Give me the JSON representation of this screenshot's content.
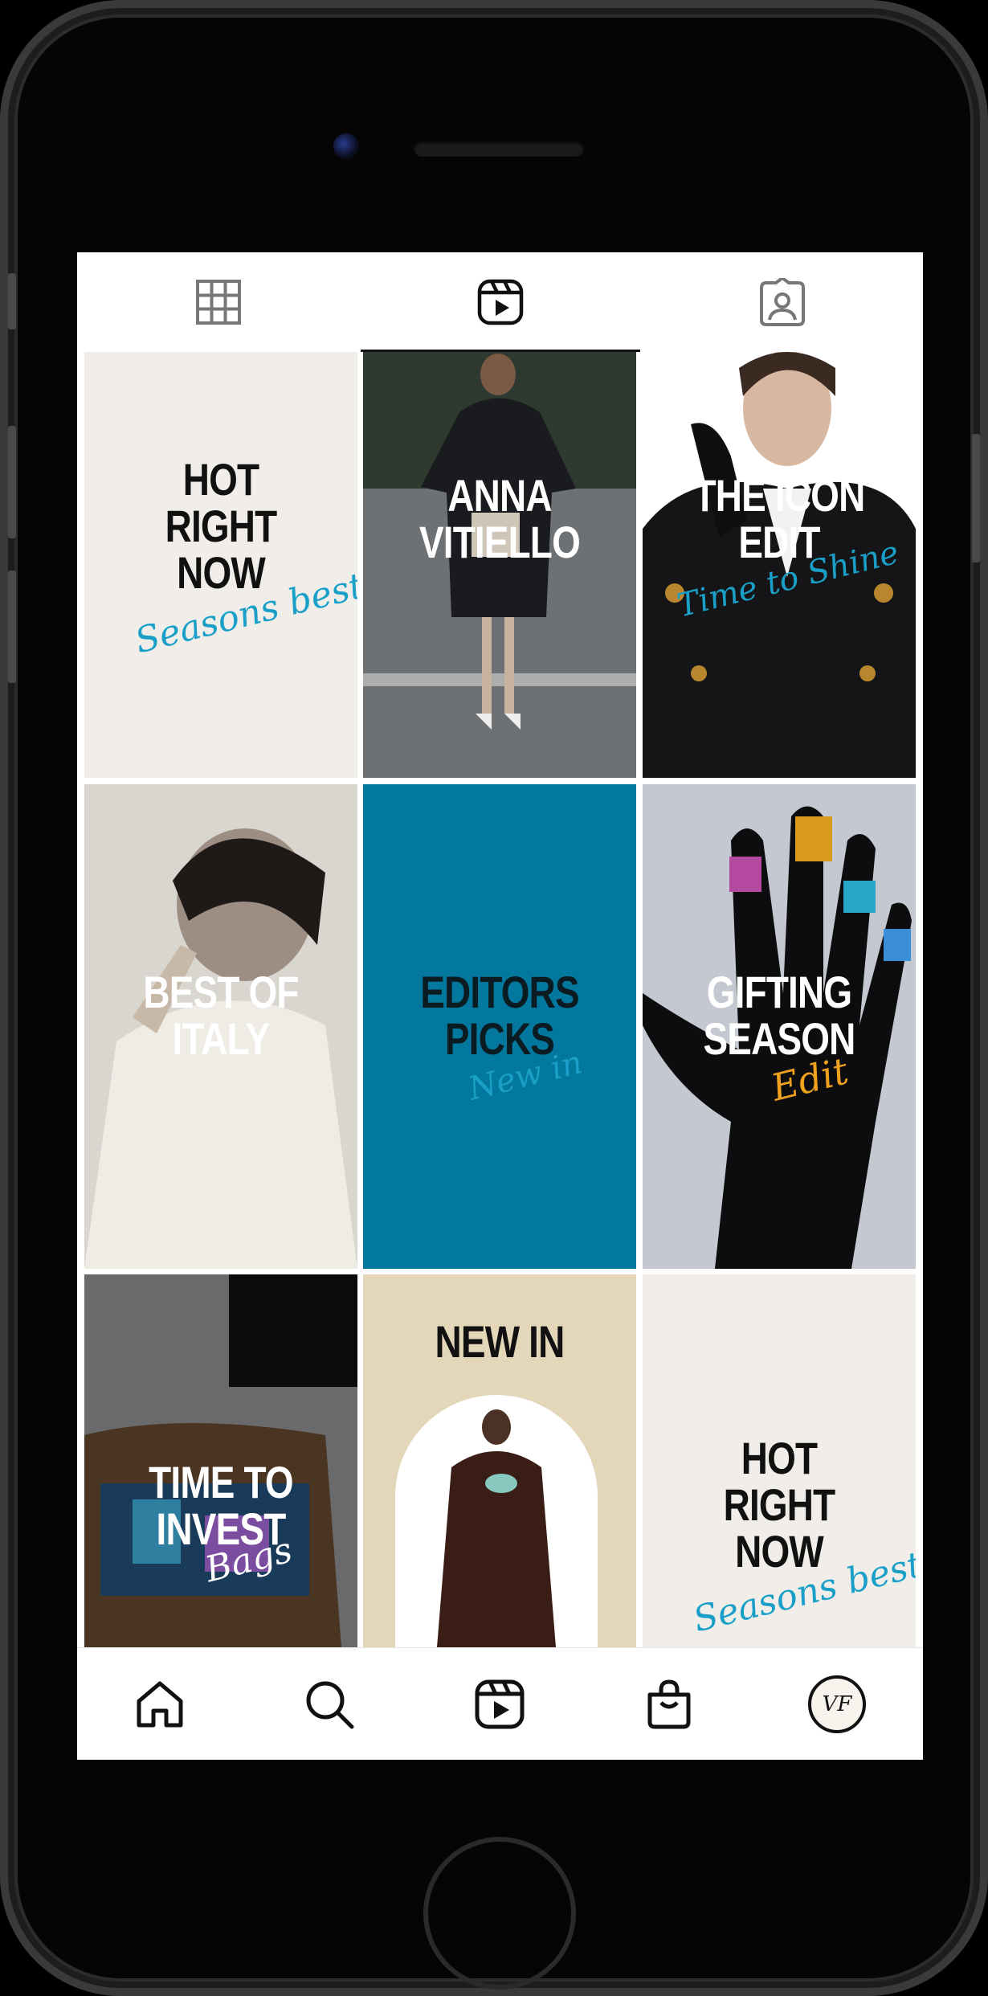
{
  "top_tabs": [
    {
      "name": "grid",
      "icon": "grid-icon"
    },
    {
      "name": "reels",
      "icon": "reels-icon",
      "active": true
    },
    {
      "name": "tagged",
      "icon": "tagged-icon"
    }
  ],
  "tiles": [
    {
      "title_lines": [
        "HOT",
        "RIGHT",
        "NOW"
      ],
      "script": "Seasons best",
      "bg": "#f1eee9",
      "title_color": "#111111",
      "script_color": "#1aa0c8"
    },
    {
      "title_lines": [
        "ANNA",
        "VITIELLO"
      ],
      "script": "",
      "bg": "#5b5f60",
      "title_color": "#ffffff",
      "script_color": ""
    },
    {
      "title_lines": [
        "THE ICON",
        "EDIT"
      ],
      "script": "Time to Shine",
      "bg": "#1a1a1c",
      "title_color": "#ffffff",
      "script_color": "#1aa0c8"
    },
    {
      "title_lines": [
        "BEST OF",
        "ITALY"
      ],
      "script": "",
      "bg": "#a7a49f",
      "title_color": "#ffffff",
      "script_color": ""
    },
    {
      "title_lines": [
        "EDITORS",
        "PICKS"
      ],
      "script": "New in",
      "bg": "#03789e",
      "title_color": "#0b1b22",
      "script_color": "#1aa0c8"
    },
    {
      "title_lines": [
        "GIFTING",
        "SEASON"
      ],
      "script": "Edit",
      "bg": "#c9ccd3",
      "title_color": "#ffffff",
      "script_color": "#f0a21e"
    },
    {
      "title_lines": [
        "TIME TO",
        "INVEST"
      ],
      "script": "Bags",
      "bg": "#5c5c5e",
      "title_color": "#ffffff",
      "script_color": "#ffffff"
    },
    {
      "title_lines": [
        "NEW IN"
      ],
      "script": "",
      "bg": "#e3d6b9",
      "title_color": "#111111",
      "script_color": ""
    },
    {
      "title_lines": [
        "HOT",
        "RIGHT",
        "NOW"
      ],
      "script": "Seasons best",
      "bg": "#f1eee9",
      "title_color": "#111111",
      "script_color": "#1aa0c8"
    }
  ],
  "bottom_nav": [
    {
      "name": "home",
      "icon": "home-icon"
    },
    {
      "name": "search",
      "icon": "search-icon"
    },
    {
      "name": "reels",
      "icon": "reels-icon"
    },
    {
      "name": "shop",
      "icon": "shopping-bag-icon"
    },
    {
      "name": "profile",
      "icon": "profile-avatar-icon",
      "avatar_letters": "VF"
    }
  ]
}
